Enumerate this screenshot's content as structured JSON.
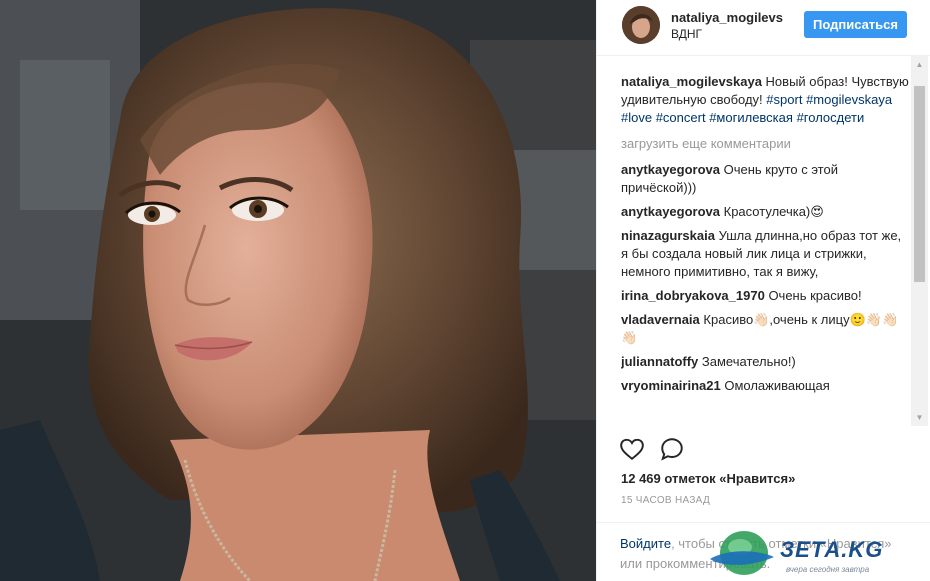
{
  "header": {
    "username": "nataliya_mogilevskaya",
    "location": "ВДНГ",
    "follow_label": "Подписаться"
  },
  "caption": {
    "username": "nataliya_mogilevskaya",
    "text": "Новый образ! Чувствую удивительную свободу!",
    "hashtags": [
      "#sport",
      "#mogilevskaya",
      "#love",
      "#concert",
      "#могилевская",
      "#голосдети"
    ]
  },
  "load_more_label": "загрузить еще комментарии",
  "comments": [
    {
      "username": "anytkayegorova",
      "text": "Очень круто с этой причёской)))"
    },
    {
      "username": "anytkayegorova",
      "text": "Красотулечка)😍"
    },
    {
      "username": "ninazagurskaia",
      "text": "Ушла длинна,но образ тот же, я бы создала новый лик лица и стрижки, немного примитивно, так я вижу,"
    },
    {
      "username": "irina_dobryakova_1970",
      "text": "Очень красиво!"
    },
    {
      "username": "vladavernaia",
      "text": "Красиво👋🏻,очень к лицу🙂👋🏻👋🏻👋🏻"
    },
    {
      "username": "juliannatoffy",
      "text": "Замечательно!)"
    },
    {
      "username": "vryominairina21",
      "text": "Омолаживающая"
    }
  ],
  "actions": {
    "like_icon": "heart-outline-icon",
    "comment_icon": "speech-bubble-icon"
  },
  "likes_text": "12 469 отметок «Нравится»",
  "time_text": "15 ЧАСОВ НАЗАД",
  "login_prompt": {
    "login_link": "Войдите",
    "text_part1": ", чтобы ставить отметки «Нравится»",
    "text_part2": "или прокомментировать."
  },
  "watermark": {
    "brand": "ЗЕТА.KG",
    "tagline": "вчера сегодня завтра"
  },
  "colors": {
    "follow_button": "#3897f0",
    "link": "#003569",
    "muted": "#999999"
  }
}
